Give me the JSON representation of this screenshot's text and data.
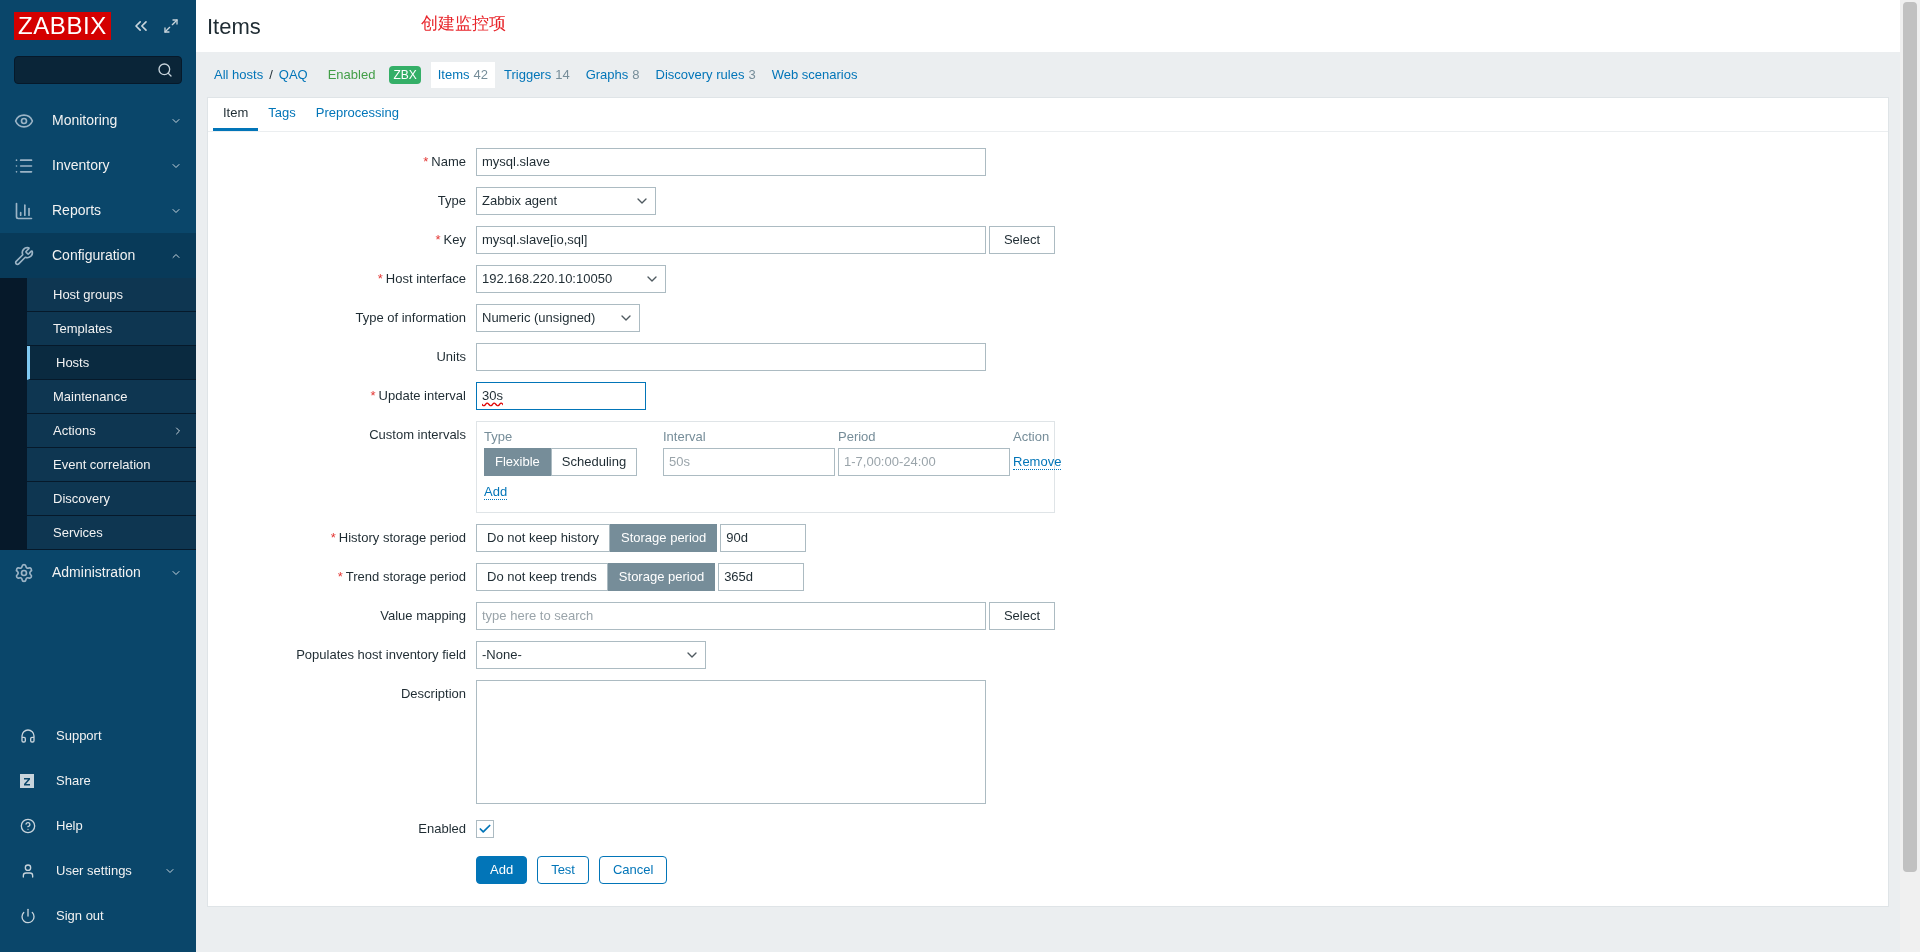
{
  "logo": "ZABBIX",
  "required_mark": "*",
  "menu": [
    {
      "label": "Monitoring",
      "expanded": false
    },
    {
      "label": "Inventory",
      "expanded": false
    },
    {
      "label": "Reports",
      "expanded": false
    },
    {
      "label": "Configuration",
      "expanded": true,
      "children": [
        {
          "label": "Host groups",
          "selected": false,
          "has_submenu": false
        },
        {
          "label": "Templates",
          "selected": false,
          "has_submenu": false
        },
        {
          "label": "Hosts",
          "selected": true,
          "has_submenu": false
        },
        {
          "label": "Maintenance",
          "selected": false,
          "has_submenu": false
        },
        {
          "label": "Actions",
          "selected": false,
          "has_submenu": true
        },
        {
          "label": "Event correlation",
          "selected": false,
          "has_submenu": false
        },
        {
          "label": "Discovery",
          "selected": false,
          "has_submenu": false
        },
        {
          "label": "Services",
          "selected": false,
          "has_submenu": false
        }
      ]
    },
    {
      "label": "Administration",
      "expanded": false
    }
  ],
  "user_menu": [
    {
      "label": "Support",
      "has_submenu": false
    },
    {
      "label": "Share",
      "has_submenu": false
    },
    {
      "label": "Help",
      "has_submenu": false
    },
    {
      "label": "User settings",
      "has_submenu": true
    },
    {
      "label": "Sign out",
      "has_submenu": false
    }
  ],
  "header": {
    "title": "Items",
    "annotation": "创建监控项"
  },
  "host_nav": {
    "breadcrumb": [
      "All hosts",
      "QAQ"
    ],
    "separator": "/",
    "status": "Enabled",
    "badge": "ZBX",
    "tabs": [
      {
        "label": "Items",
        "count": "42",
        "selected": true
      },
      {
        "label": "Triggers",
        "count": "14",
        "selected": false
      },
      {
        "label": "Graphs",
        "count": "8",
        "selected": false
      },
      {
        "label": "Discovery rules",
        "count": "3",
        "selected": false
      },
      {
        "label": "Web scenarios",
        "selected": false
      }
    ]
  },
  "form_tabs": [
    {
      "label": "Item",
      "selected": true
    },
    {
      "label": "Tags",
      "selected": false
    },
    {
      "label": "Preprocessing",
      "selected": false
    }
  ],
  "fields": [
    {
      "label": "Name",
      "required": true,
      "kind": "text",
      "value": "mysql.slave"
    },
    {
      "label": "Type",
      "required": false,
      "kind": "select",
      "value": "Zabbix agent"
    },
    {
      "label": "Key",
      "required": true,
      "kind": "text_button",
      "value": "mysql.slave[io,sql]",
      "button": "Select"
    },
    {
      "label": "Host interface",
      "required": true,
      "kind": "select",
      "value": "192.168.220.10:10050"
    },
    {
      "label": "Type of information",
      "required": false,
      "kind": "select",
      "value": "Numeric (unsigned)"
    },
    {
      "label": "Units",
      "required": false,
      "kind": "text"
    },
    {
      "label": "Update interval",
      "required": true,
      "kind": "short_text",
      "value": "30s",
      "focused": true
    },
    {
      "label": "Custom intervals",
      "required": false,
      "kind": "custom_intervals",
      "columns": [
        "Type",
        "Interval",
        "Period",
        "Action"
      ],
      "rows": [
        {
          "options": [
            {
              "label": "Flexible",
              "selected": true
            },
            {
              "label": "Scheduling",
              "selected": false
            }
          ],
          "interval_placeholder": "50s",
          "period_placeholder": "1-7,00:00-24:00",
          "action": "Remove"
        }
      ],
      "add": "Add"
    },
    {
      "label": "History storage period",
      "required": true,
      "kind": "storage",
      "options": [
        {
          "label": "Do not keep history",
          "selected": false
        },
        {
          "label": "Storage period",
          "selected": true
        }
      ],
      "value": "90d"
    },
    {
      "label": "Trend storage period",
      "required": true,
      "kind": "storage",
      "options": [
        {
          "label": "Do not keep trends",
          "selected": false
        },
        {
          "label": "Storage period",
          "selected": true
        }
      ],
      "value": "365d"
    },
    {
      "label": "Value mapping",
      "required": false,
      "kind": "text_button",
      "placeholder": "type here to search",
      "button": "Select"
    },
    {
      "label": "Populates host inventory field",
      "required": false,
      "kind": "select",
      "value": "-None-"
    },
    {
      "label": "Description",
      "required": false,
      "kind": "textarea"
    },
    {
      "label": "Enabled",
      "required": false,
      "kind": "checkbox",
      "checked": true
    }
  ],
  "buttons": [
    {
      "label": "Add",
      "kind": "primary"
    },
    {
      "label": "Test",
      "kind": "secondary"
    },
    {
      "label": "Cancel",
      "kind": "secondary"
    }
  ]
}
